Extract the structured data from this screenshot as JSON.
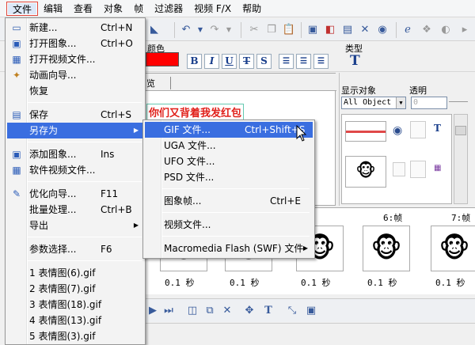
{
  "menubar": {
    "items": [
      "文件",
      "编辑",
      "查看",
      "对象",
      "帧",
      "过滤器",
      "视频 F/X",
      "帮助"
    ]
  },
  "props": {
    "color_label": "颜色",
    "type_label": "类型"
  },
  "canvas": {
    "tab_label": "览",
    "text": "你们又背着我发红包"
  },
  "right_panel": {
    "display_label": "显示对象",
    "display_value": "All Object",
    "opacity_label": "透明",
    "opacity_value": "0"
  },
  "frames": [
    {
      "label": "",
      "time": "0.1 秒"
    },
    {
      "label": "",
      "time": "0.1 秒"
    },
    {
      "label": "",
      "time": "0.1 秒"
    },
    {
      "label": "6:帧",
      "time": "0.1 秒"
    },
    {
      "label": "7:帧",
      "time": "0.1 秒"
    }
  ],
  "file_menu": {
    "items": [
      {
        "label": "新建...",
        "shortcut": "Ctrl+N",
        "icon": "new-file-icon"
      },
      {
        "label": "打开图象...",
        "shortcut": "Ctrl+O",
        "icon": "open-image-icon"
      },
      {
        "label": "打开视频文件...",
        "shortcut": "",
        "icon": "open-video-icon"
      },
      {
        "label": "动画向导...",
        "shortcut": "",
        "icon": "wizard-icon"
      },
      {
        "label": "恢复",
        "shortcut": "",
        "icon": ""
      },
      {
        "label": "保存",
        "shortcut": "Ctrl+S",
        "icon": "save-icon"
      },
      {
        "label": "另存为",
        "shortcut": "",
        "icon": ""
      },
      {
        "label": "添加图象...",
        "shortcut": "Ins",
        "icon": "add-image-icon"
      },
      {
        "label": "软件视频文件...",
        "shortcut": "",
        "icon": "software-video-icon"
      },
      {
        "label": "优化向导...",
        "shortcut": "F11",
        "icon": "optimize-icon"
      },
      {
        "label": "批量处理...",
        "shortcut": "Ctrl+B",
        "icon": ""
      },
      {
        "label": "导出",
        "shortcut": "",
        "icon": ""
      },
      {
        "label": "参数选择...",
        "shortcut": "F6",
        "icon": ""
      },
      {
        "label": "1 表情图(6).gif",
        "shortcut": "",
        "icon": ""
      },
      {
        "label": "2 表情图(7).gif",
        "shortcut": "",
        "icon": ""
      },
      {
        "label": "3 表情图(18).gif",
        "shortcut": "",
        "icon": ""
      },
      {
        "label": "4 表情图(13).gif",
        "shortcut": "",
        "icon": ""
      },
      {
        "label": "5 表情图(3).gif",
        "shortcut": "",
        "icon": ""
      }
    ]
  },
  "save_as_menu": {
    "items": [
      {
        "label": "GIF 文件...",
        "shortcut": "Ctrl+Shift+S"
      },
      {
        "label": "UGA 文件...",
        "shortcut": ""
      },
      {
        "label": "UFO 文件...",
        "shortcut": ""
      },
      {
        "label": "PSD 文件...",
        "shortcut": ""
      },
      {
        "label": "图象帧...",
        "shortcut": "Ctrl+E"
      },
      {
        "label": "视频文件...",
        "shortcut": ""
      },
      {
        "label": "Macromedia Flash (SWF) 文件",
        "shortcut": ""
      }
    ]
  },
  "colors": {
    "menu_highlight": "#3a6ee0",
    "canvas_text": "#e0201a",
    "color_swatch": "#ff0000"
  }
}
